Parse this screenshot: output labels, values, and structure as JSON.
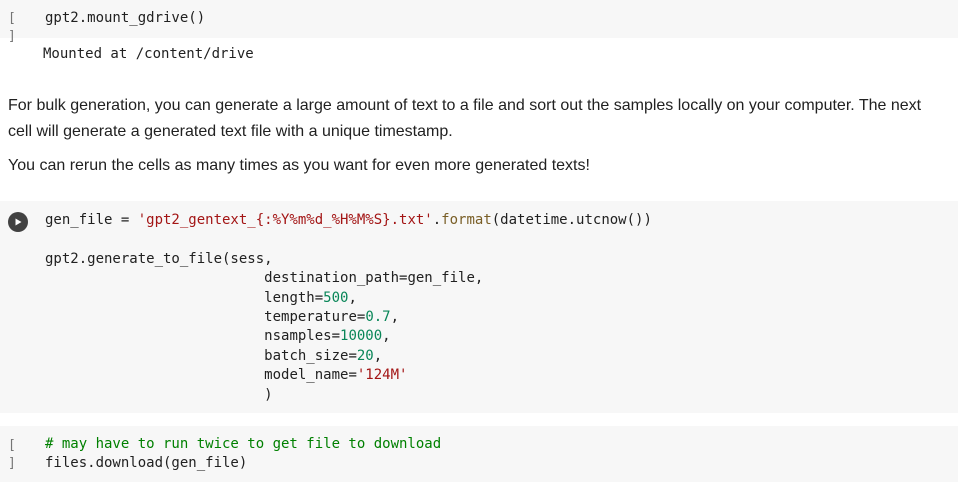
{
  "cell1": {
    "bracket": "[ ]",
    "code": "gpt2.mount_gdrive()",
    "output": "Mounted at /content/drive"
  },
  "markdown": {
    "p1": "For bulk generation, you can generate a large amount of text to a file and sort out the samples locally on your computer. The next cell will generate a generated text file with a unique timestamp.",
    "p2": "You can rerun the cells as many times as you want for even more generated texts!"
  },
  "cell2": {
    "run_icon": "play-icon",
    "line1": {
      "a": "gen_file = ",
      "b": "'gpt2_gentext_{:%Y%m%d_%H%M%S}.txt'",
      "c": ".",
      "d": "format",
      "e": "(datetime.utcnow())"
    },
    "line2": "gpt2.generate_to_file(sess,",
    "line3": "destination_path=gen_file,",
    "line4": {
      "k": "length=",
      "v": "500",
      "t": ","
    },
    "line5": {
      "k": "temperature=",
      "v": "0.7",
      "t": ","
    },
    "line6": {
      "k": "nsamples=",
      "v": "10000",
      "t": ","
    },
    "line7": {
      "k": "batch_size=",
      "v": "20",
      "t": ","
    },
    "line8": {
      "k": "model_name=",
      "v": "'124M'"
    },
    "line9": ")"
  },
  "cell3": {
    "bracket": "[ ]",
    "comment": "# may have to run twice to get file to download",
    "code": "files.download(gen_file)"
  },
  "colors": {
    "cell_bg": "#f7f7f7",
    "string": "#a31515",
    "number": "#098658",
    "function": "#795e26",
    "comment": "#008000"
  }
}
